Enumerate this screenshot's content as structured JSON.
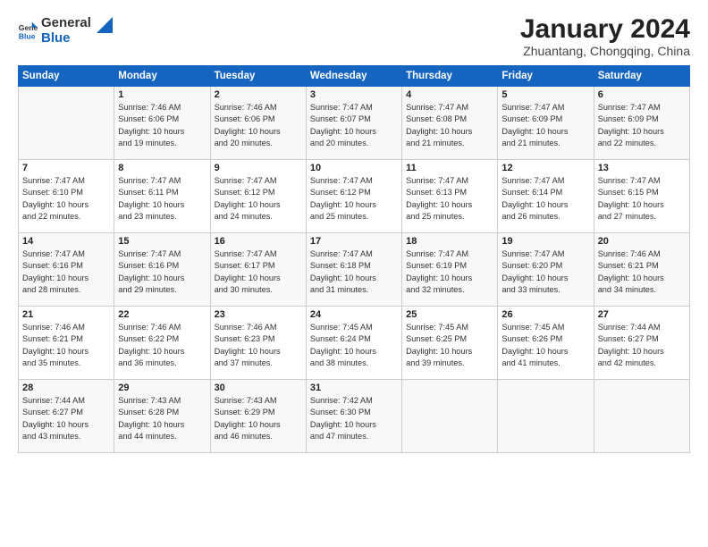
{
  "header": {
    "logo_general": "General",
    "logo_blue": "Blue",
    "month_year": "January 2024",
    "location": "Zhuantang, Chongqing, China"
  },
  "days_of_week": [
    "Sunday",
    "Monday",
    "Tuesday",
    "Wednesday",
    "Thursday",
    "Friday",
    "Saturday"
  ],
  "weeks": [
    [
      {
        "day": "",
        "sunrise": "",
        "sunset": "",
        "daylight": ""
      },
      {
        "day": "1",
        "sunrise": "Sunrise: 7:46 AM",
        "sunset": "Sunset: 6:06 PM",
        "daylight": "Daylight: 10 hours and 19 minutes."
      },
      {
        "day": "2",
        "sunrise": "Sunrise: 7:46 AM",
        "sunset": "Sunset: 6:06 PM",
        "daylight": "Daylight: 10 hours and 20 minutes."
      },
      {
        "day": "3",
        "sunrise": "Sunrise: 7:47 AM",
        "sunset": "Sunset: 6:07 PM",
        "daylight": "Daylight: 10 hours and 20 minutes."
      },
      {
        "day": "4",
        "sunrise": "Sunrise: 7:47 AM",
        "sunset": "Sunset: 6:08 PM",
        "daylight": "Daylight: 10 hours and 21 minutes."
      },
      {
        "day": "5",
        "sunrise": "Sunrise: 7:47 AM",
        "sunset": "Sunset: 6:09 PM",
        "daylight": "Daylight: 10 hours and 21 minutes."
      },
      {
        "day": "6",
        "sunrise": "Sunrise: 7:47 AM",
        "sunset": "Sunset: 6:09 PM",
        "daylight": "Daylight: 10 hours and 22 minutes."
      }
    ],
    [
      {
        "day": "7",
        "sunrise": "Sunrise: 7:47 AM",
        "sunset": "Sunset: 6:10 PM",
        "daylight": "Daylight: 10 hours and 22 minutes."
      },
      {
        "day": "8",
        "sunrise": "Sunrise: 7:47 AM",
        "sunset": "Sunset: 6:11 PM",
        "daylight": "Daylight: 10 hours and 23 minutes."
      },
      {
        "day": "9",
        "sunrise": "Sunrise: 7:47 AM",
        "sunset": "Sunset: 6:12 PM",
        "daylight": "Daylight: 10 hours and 24 minutes."
      },
      {
        "day": "10",
        "sunrise": "Sunrise: 7:47 AM",
        "sunset": "Sunset: 6:12 PM",
        "daylight": "Daylight: 10 hours and 25 minutes."
      },
      {
        "day": "11",
        "sunrise": "Sunrise: 7:47 AM",
        "sunset": "Sunset: 6:13 PM",
        "daylight": "Daylight: 10 hours and 25 minutes."
      },
      {
        "day": "12",
        "sunrise": "Sunrise: 7:47 AM",
        "sunset": "Sunset: 6:14 PM",
        "daylight": "Daylight: 10 hours and 26 minutes."
      },
      {
        "day": "13",
        "sunrise": "Sunrise: 7:47 AM",
        "sunset": "Sunset: 6:15 PM",
        "daylight": "Daylight: 10 hours and 27 minutes."
      }
    ],
    [
      {
        "day": "14",
        "sunrise": "Sunrise: 7:47 AM",
        "sunset": "Sunset: 6:16 PM",
        "daylight": "Daylight: 10 hours and 28 minutes."
      },
      {
        "day": "15",
        "sunrise": "Sunrise: 7:47 AM",
        "sunset": "Sunset: 6:16 PM",
        "daylight": "Daylight: 10 hours and 29 minutes."
      },
      {
        "day": "16",
        "sunrise": "Sunrise: 7:47 AM",
        "sunset": "Sunset: 6:17 PM",
        "daylight": "Daylight: 10 hours and 30 minutes."
      },
      {
        "day": "17",
        "sunrise": "Sunrise: 7:47 AM",
        "sunset": "Sunset: 6:18 PM",
        "daylight": "Daylight: 10 hours and 31 minutes."
      },
      {
        "day": "18",
        "sunrise": "Sunrise: 7:47 AM",
        "sunset": "Sunset: 6:19 PM",
        "daylight": "Daylight: 10 hours and 32 minutes."
      },
      {
        "day": "19",
        "sunrise": "Sunrise: 7:47 AM",
        "sunset": "Sunset: 6:20 PM",
        "daylight": "Daylight: 10 hours and 33 minutes."
      },
      {
        "day": "20",
        "sunrise": "Sunrise: 7:46 AM",
        "sunset": "Sunset: 6:21 PM",
        "daylight": "Daylight: 10 hours and 34 minutes."
      }
    ],
    [
      {
        "day": "21",
        "sunrise": "Sunrise: 7:46 AM",
        "sunset": "Sunset: 6:21 PM",
        "daylight": "Daylight: 10 hours and 35 minutes."
      },
      {
        "day": "22",
        "sunrise": "Sunrise: 7:46 AM",
        "sunset": "Sunset: 6:22 PM",
        "daylight": "Daylight: 10 hours and 36 minutes."
      },
      {
        "day": "23",
        "sunrise": "Sunrise: 7:46 AM",
        "sunset": "Sunset: 6:23 PM",
        "daylight": "Daylight: 10 hours and 37 minutes."
      },
      {
        "day": "24",
        "sunrise": "Sunrise: 7:45 AM",
        "sunset": "Sunset: 6:24 PM",
        "daylight": "Daylight: 10 hours and 38 minutes."
      },
      {
        "day": "25",
        "sunrise": "Sunrise: 7:45 AM",
        "sunset": "Sunset: 6:25 PM",
        "daylight": "Daylight: 10 hours and 39 minutes."
      },
      {
        "day": "26",
        "sunrise": "Sunrise: 7:45 AM",
        "sunset": "Sunset: 6:26 PM",
        "daylight": "Daylight: 10 hours and 41 minutes."
      },
      {
        "day": "27",
        "sunrise": "Sunrise: 7:44 AM",
        "sunset": "Sunset: 6:27 PM",
        "daylight": "Daylight: 10 hours and 42 minutes."
      }
    ],
    [
      {
        "day": "28",
        "sunrise": "Sunrise: 7:44 AM",
        "sunset": "Sunset: 6:27 PM",
        "daylight": "Daylight: 10 hours and 43 minutes."
      },
      {
        "day": "29",
        "sunrise": "Sunrise: 7:43 AM",
        "sunset": "Sunset: 6:28 PM",
        "daylight": "Daylight: 10 hours and 44 minutes."
      },
      {
        "day": "30",
        "sunrise": "Sunrise: 7:43 AM",
        "sunset": "Sunset: 6:29 PM",
        "daylight": "Daylight: 10 hours and 46 minutes."
      },
      {
        "day": "31",
        "sunrise": "Sunrise: 7:42 AM",
        "sunset": "Sunset: 6:30 PM",
        "daylight": "Daylight: 10 hours and 47 minutes."
      },
      {
        "day": "",
        "sunrise": "",
        "sunset": "",
        "daylight": ""
      },
      {
        "day": "",
        "sunrise": "",
        "sunset": "",
        "daylight": ""
      },
      {
        "day": "",
        "sunrise": "",
        "sunset": "",
        "daylight": ""
      }
    ]
  ]
}
